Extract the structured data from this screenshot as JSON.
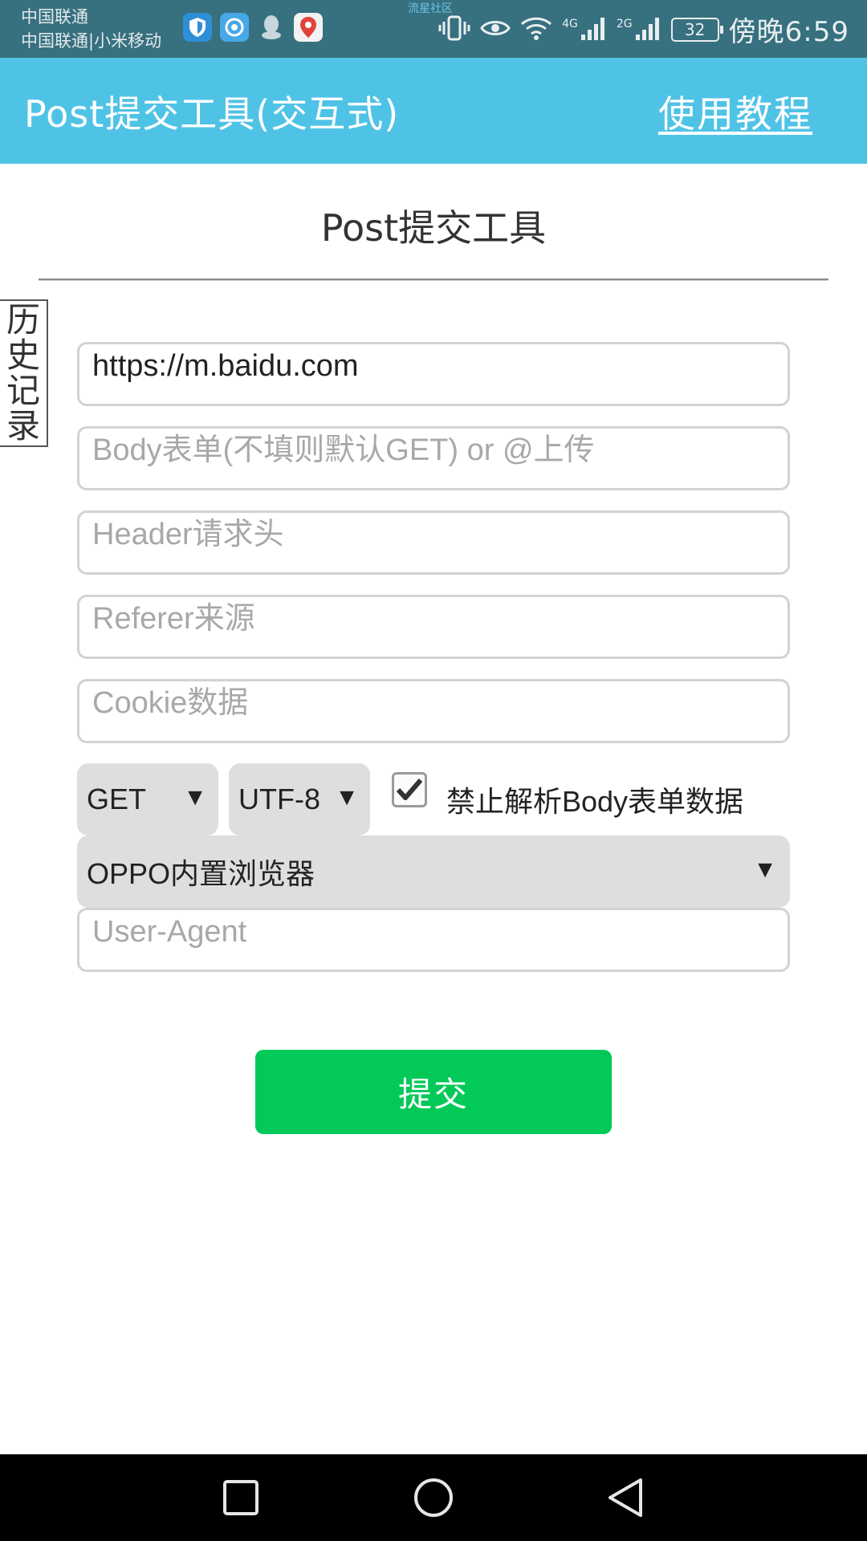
{
  "status_bar": {
    "carrier_line1": "中国联通",
    "carrier_line2": "中国联通|小米移动",
    "watermark": "流星社区",
    "net_1": "4G",
    "net_2": "2G",
    "battery": "32",
    "clock": "傍晚6:59",
    "icons_left": [
      "shield-app-icon",
      "browser-app-icon",
      "qq-icon",
      "baidu-map-icon"
    ],
    "icons_right": [
      "vibrate-icon",
      "eye-icon",
      "wifi-icon",
      "signal-icon",
      "signal-icon",
      "battery-icon"
    ]
  },
  "app_bar": {
    "title": "Post提交工具(交互式)",
    "help_link": "使用教程",
    "background": "#4fc3e6"
  },
  "page": {
    "title": "Post提交工具",
    "history_tab": [
      "历",
      "史",
      "记",
      "录"
    ]
  },
  "form": {
    "url": {
      "value": "https://m.baidu.com",
      "placeholder": ""
    },
    "body": {
      "value": "",
      "placeholder": "Body表单(不填则默认GET) or @上传"
    },
    "header": {
      "value": "",
      "placeholder": "Header请求头"
    },
    "referer": {
      "value": "",
      "placeholder": "Referer来源"
    },
    "cookie": {
      "value": "",
      "placeholder": "Cookie数据"
    },
    "method": {
      "selected": "GET"
    },
    "encoding": {
      "selected": "UTF-8"
    },
    "disable_parse": {
      "checked": true,
      "label": "禁止解析Body表单数据"
    },
    "ua_preset": {
      "selected": "OPPO内置浏览器"
    },
    "user_agent": {
      "value": "",
      "placeholder": "User-Agent"
    },
    "submit_label": "提交",
    "submit_color": "#02c958"
  },
  "nav_bar": {
    "buttons": [
      "recents-square-icon",
      "home-circle-icon",
      "back-triangle-icon"
    ]
  }
}
